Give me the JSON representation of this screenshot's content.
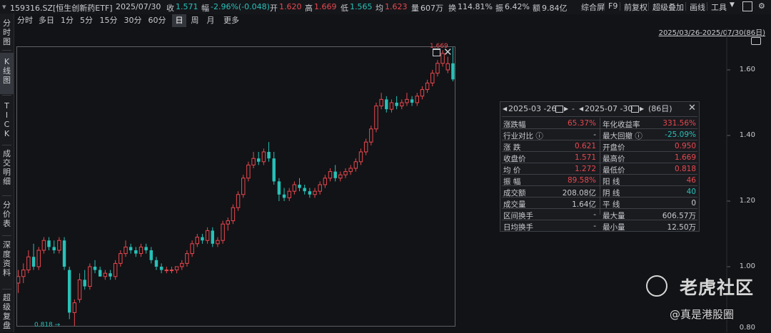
{
  "quote": {
    "symbol": "159316.SZ[恒生创新药ETF]",
    "date": "2025/07/30",
    "close_label": "收",
    "close": "1.571",
    "change_label": "幅",
    "change": "-2.96%(-0.048)",
    "open_label": "开",
    "open": "1.620",
    "high_label": "高",
    "high": "1.669",
    "low_label": "低",
    "low": "1.565",
    "avg_label": "均",
    "avg": "1.623",
    "vol_label": "量",
    "vol": "607万",
    "turnover_label": "换",
    "turnover": "114.81%",
    "amp_label": "振",
    "amp": "6.42%",
    "amount_label": "额",
    "amount": "9.84亿"
  },
  "toolbar": [
    "综合屏",
    "F9",
    "前复权",
    "超级叠加",
    "画线",
    "工具"
  ],
  "periods": [
    "分时",
    "多日",
    "1分",
    "5分",
    "15分",
    "30分",
    "60分",
    "日",
    "周",
    "月",
    "更多"
  ],
  "active_period": "日",
  "sidebar": [
    "分时图",
    "K线图",
    "TICK",
    "成交明细",
    "分价表",
    "深度资料",
    "超级复盘"
  ],
  "range_label": "2025/03/26-2025/07/30(86日)",
  "y_axis": [
    "1.60",
    "1.40",
    "1.20",
    "1.00",
    "0.80"
  ],
  "markers": {
    "high": "1.669",
    "low": "0.818"
  },
  "panel": {
    "start_date": "2025-03 -26",
    "dash": "-",
    "end_date": "2025-07 -30",
    "count": "(86日)",
    "rows": [
      [
        "涨跌幅",
        "65.37%",
        "年化收益率",
        "331.56%"
      ],
      [
        "行业对比 ⓘ",
        "-",
        "最大回撤 ⓘ",
        "-25.09%"
      ],
      [
        "涨  跌",
        "0.621",
        "开盘价",
        "0.950"
      ],
      [
        "收盘价",
        "1.571",
        "最高价",
        "1.669"
      ],
      [
        "均  价",
        "1.272",
        "最低价",
        "0.818"
      ],
      [
        "振  幅",
        "89.58%",
        "阳  线",
        "46"
      ],
      [
        "成交额",
        "208.08亿",
        "阴  线",
        "40"
      ],
      [
        "成交量",
        "1.64亿",
        "平  线",
        "0"
      ],
      [
        "区间换手",
        "-",
        "最大量",
        "606.57万"
      ],
      [
        "日均换手",
        "-",
        "最小量",
        "12.50万"
      ]
    ]
  },
  "watermark": {
    "brand": "老虎社区",
    "author": "@真是港股圈"
  },
  "colors": {
    "up": "#e8484f",
    "down": "#27c1b8",
    "bg": "#121316",
    "text": "#c9cbd0"
  },
  "chart_data": {
    "type": "candlestick",
    "title": "",
    "x_range": [
      "2025-03-26",
      "2025-07-30"
    ],
    "ylim": [
      0.8,
      1.65
    ],
    "y_ticks": [
      1.6,
      1.4,
      1.2,
      1.0,
      0.8
    ],
    "candles": [
      {
        "o": 0.95,
        "h": 0.99,
        "l": 0.92,
        "c": 0.97
      },
      {
        "o": 0.97,
        "h": 1.01,
        "l": 0.95,
        "c": 0.99
      },
      {
        "o": 0.99,
        "h": 1.05,
        "l": 0.98,
        "c": 1.03
      },
      {
        "o": 1.03,
        "h": 1.07,
        "l": 0.99,
        "c": 1.0
      },
      {
        "o": 1.0,
        "h": 1.06,
        "l": 0.99,
        "c": 1.05
      },
      {
        "o": 1.05,
        "h": 1.09,
        "l": 1.04,
        "c": 1.08
      },
      {
        "o": 1.08,
        "h": 1.09,
        "l": 1.05,
        "c": 1.06
      },
      {
        "o": 1.06,
        "h": 1.08,
        "l": 1.04,
        "c": 1.05
      },
      {
        "o": 1.05,
        "h": 1.09,
        "l": 1.04,
        "c": 1.08
      },
      {
        "o": 1.08,
        "h": 1.09,
        "l": 0.99,
        "c": 1.0
      },
      {
        "o": 0.99,
        "h": 1.0,
        "l": 0.84,
        "c": 0.86
      },
      {
        "o": 0.86,
        "h": 0.9,
        "l": 0.818,
        "c": 0.89
      },
      {
        "o": 0.9,
        "h": 0.98,
        "l": 0.89,
        "c": 0.96
      },
      {
        "o": 0.96,
        "h": 0.99,
        "l": 0.93,
        "c": 0.94
      },
      {
        "o": 0.94,
        "h": 1.01,
        "l": 0.93,
        "c": 1.0
      },
      {
        "o": 1.0,
        "h": 1.02,
        "l": 0.98,
        "c": 0.99
      },
      {
        "o": 0.99,
        "h": 1.0,
        "l": 0.97,
        "c": 0.97
      },
      {
        "o": 0.97,
        "h": 0.99,
        "l": 0.96,
        "c": 0.98
      },
      {
        "o": 0.98,
        "h": 0.99,
        "l": 0.96,
        "c": 0.97
      },
      {
        "o": 0.97,
        "h": 1.02,
        "l": 0.96,
        "c": 1.01
      },
      {
        "o": 1.01,
        "h": 1.05,
        "l": 1.0,
        "c": 1.04
      },
      {
        "o": 1.04,
        "h": 1.08,
        "l": 1.03,
        "c": 1.06
      },
      {
        "o": 1.06,
        "h": 1.07,
        "l": 1.04,
        "c": 1.05
      },
      {
        "o": 1.05,
        "h": 1.06,
        "l": 1.03,
        "c": 1.04
      },
      {
        "o": 1.04,
        "h": 1.07,
        "l": 1.03,
        "c": 1.06
      },
      {
        "o": 1.06,
        "h": 1.07,
        "l": 1.04,
        "c": 1.05
      },
      {
        "o": 1.05,
        "h": 1.06,
        "l": 1.01,
        "c": 1.02
      },
      {
        "o": 1.02,
        "h": 1.03,
        "l": 0.99,
        "c": 1.0
      },
      {
        "o": 1.0,
        "h": 1.01,
        "l": 0.98,
        "c": 0.99
      },
      {
        "o": 0.99,
        "h": 1.0,
        "l": 0.98,
        "c": 0.99
      },
      {
        "o": 0.99,
        "h": 1.0,
        "l": 0.98,
        "c": 0.99
      },
      {
        "o": 0.99,
        "h": 1.0,
        "l": 0.98,
        "c": 1.0
      },
      {
        "o": 1.0,
        "h": 1.02,
        "l": 0.99,
        "c": 1.01
      },
      {
        "o": 1.01,
        "h": 1.05,
        "l": 1.0,
        "c": 1.04
      },
      {
        "o": 1.04,
        "h": 1.08,
        "l": 1.03,
        "c": 1.07
      },
      {
        "o": 1.07,
        "h": 1.1,
        "l": 1.06,
        "c": 1.09
      },
      {
        "o": 1.09,
        "h": 1.1,
        "l": 1.07,
        "c": 1.08
      },
      {
        "o": 1.08,
        "h": 1.12,
        "l": 1.07,
        "c": 1.11
      },
      {
        "o": 1.11,
        "h": 1.12,
        "l": 1.06,
        "c": 1.07
      },
      {
        "o": 1.07,
        "h": 1.09,
        "l": 1.06,
        "c": 1.08
      },
      {
        "o": 1.08,
        "h": 1.14,
        "l": 1.07,
        "c": 1.13
      },
      {
        "o": 1.13,
        "h": 1.15,
        "l": 1.11,
        "c": 1.14
      },
      {
        "o": 1.14,
        "h": 1.19,
        "l": 1.13,
        "c": 1.18
      },
      {
        "o": 1.18,
        "h": 1.23,
        "l": 1.17,
        "c": 1.22
      },
      {
        "o": 1.22,
        "h": 1.28,
        "l": 1.21,
        "c": 1.27
      },
      {
        "o": 1.27,
        "h": 1.32,
        "l": 1.26,
        "c": 1.31
      },
      {
        "o": 1.31,
        "h": 1.35,
        "l": 1.3,
        "c": 1.33
      },
      {
        "o": 1.33,
        "h": 1.35,
        "l": 1.31,
        "c": 1.32
      },
      {
        "o": 1.32,
        "h": 1.36,
        "l": 1.31,
        "c": 1.35
      },
      {
        "o": 1.35,
        "h": 1.38,
        "l": 1.32,
        "c": 1.33
      },
      {
        "o": 1.33,
        "h": 1.35,
        "l": 1.25,
        "c": 1.26
      },
      {
        "o": 1.26,
        "h": 1.27,
        "l": 1.2,
        "c": 1.22
      },
      {
        "o": 1.22,
        "h": 1.24,
        "l": 1.2,
        "c": 1.21
      },
      {
        "o": 1.21,
        "h": 1.24,
        "l": 1.2,
        "c": 1.23
      },
      {
        "o": 1.23,
        "h": 1.26,
        "l": 1.22,
        "c": 1.25
      },
      {
        "o": 1.25,
        "h": 1.27,
        "l": 1.23,
        "c": 1.24
      },
      {
        "o": 1.24,
        "h": 1.25,
        "l": 1.22,
        "c": 1.23
      },
      {
        "o": 1.23,
        "h": 1.24,
        "l": 1.21,
        "c": 1.22
      },
      {
        "o": 1.22,
        "h": 1.24,
        "l": 1.21,
        "c": 1.23
      },
      {
        "o": 1.23,
        "h": 1.26,
        "l": 1.22,
        "c": 1.25
      },
      {
        "o": 1.25,
        "h": 1.28,
        "l": 1.24,
        "c": 1.27
      },
      {
        "o": 1.27,
        "h": 1.3,
        "l": 1.26,
        "c": 1.29
      },
      {
        "o": 1.29,
        "h": 1.31,
        "l": 1.26,
        "c": 1.27
      },
      {
        "o": 1.27,
        "h": 1.29,
        "l": 1.26,
        "c": 1.28
      },
      {
        "o": 1.28,
        "h": 1.3,
        "l": 1.27,
        "c": 1.29
      },
      {
        "o": 1.29,
        "h": 1.31,
        "l": 1.28,
        "c": 1.3
      },
      {
        "o": 1.3,
        "h": 1.33,
        "l": 1.29,
        "c": 1.32
      },
      {
        "o": 1.32,
        "h": 1.36,
        "l": 1.31,
        "c": 1.35
      },
      {
        "o": 1.35,
        "h": 1.39,
        "l": 1.34,
        "c": 1.38
      },
      {
        "o": 1.38,
        "h": 1.43,
        "l": 1.37,
        "c": 1.42
      },
      {
        "o": 1.42,
        "h": 1.5,
        "l": 1.41,
        "c": 1.49
      },
      {
        "o": 1.49,
        "h": 1.53,
        "l": 1.48,
        "c": 1.51
      },
      {
        "o": 1.51,
        "h": 1.52,
        "l": 1.47,
        "c": 1.48
      },
      {
        "o": 1.48,
        "h": 1.51,
        "l": 1.47,
        "c": 1.5
      },
      {
        "o": 1.5,
        "h": 1.52,
        "l": 1.48,
        "c": 1.49
      },
      {
        "o": 1.49,
        "h": 1.51,
        "l": 1.48,
        "c": 1.5
      },
      {
        "o": 1.5,
        "h": 1.53,
        "l": 1.49,
        "c": 1.51
      },
      {
        "o": 1.51,
        "h": 1.52,
        "l": 1.49,
        "c": 1.5
      },
      {
        "o": 1.5,
        "h": 1.53,
        "l": 1.49,
        "c": 1.52
      },
      {
        "o": 1.52,
        "h": 1.55,
        "l": 1.51,
        "c": 1.54
      },
      {
        "o": 1.54,
        "h": 1.57,
        "l": 1.53,
        "c": 1.56
      },
      {
        "o": 1.56,
        "h": 1.6,
        "l": 1.55,
        "c": 1.59
      },
      {
        "o": 1.59,
        "h": 1.63,
        "l": 1.58,
        "c": 1.62
      },
      {
        "o": 1.62,
        "h": 1.66,
        "l": 1.61,
        "c": 1.65
      },
      {
        "o": 1.6,
        "h": 1.64,
        "l": 1.59,
        "c": 1.619
      },
      {
        "o": 1.62,
        "h": 1.669,
        "l": 1.565,
        "c": 1.571
      }
    ]
  }
}
